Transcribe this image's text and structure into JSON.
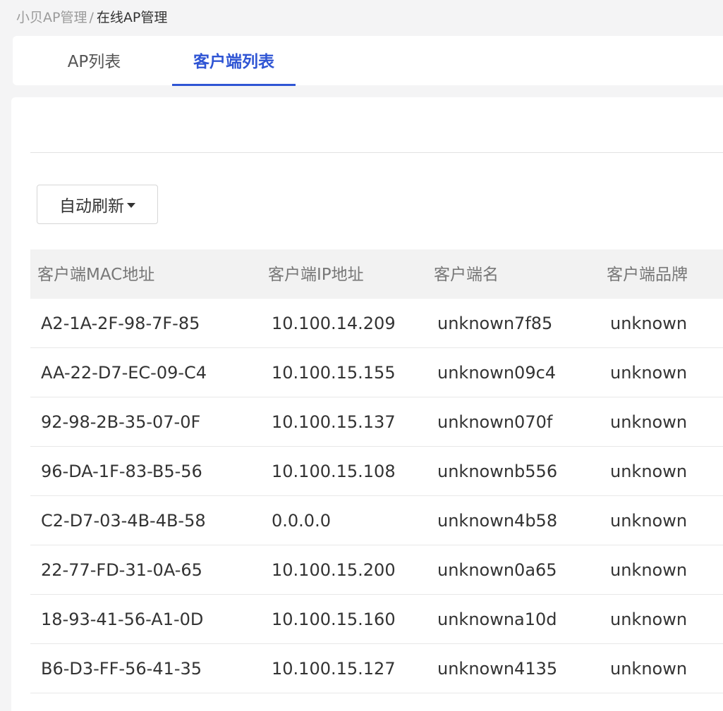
{
  "breadcrumb": {
    "root": "小贝AP管理",
    "separator": "/",
    "current": "在线AP管理"
  },
  "tabs": [
    {
      "label": "AP列表",
      "active": false
    },
    {
      "label": "客户端列表",
      "active": true
    }
  ],
  "toolbar": {
    "refresh_label": "自动刷新",
    "refresh_icon": "caret-down-icon"
  },
  "colors": {
    "accent": "#2f55d4",
    "header_bg": "#f2f2f2",
    "page_bg": "#f4f4f5"
  },
  "table": {
    "columns": [
      "客户端MAC地址",
      "客户端IP地址",
      "客户端名",
      "客户端品牌"
    ],
    "rows": [
      {
        "mac": "A2-1A-2F-98-7F-85",
        "ip": "10.100.14.209",
        "name": "unknown7f85",
        "brand": "unknown"
      },
      {
        "mac": "AA-22-D7-EC-09-C4",
        "ip": "10.100.15.155",
        "name": "unknown09c4",
        "brand": "unknown"
      },
      {
        "mac": "92-98-2B-35-07-0F",
        "ip": "10.100.15.137",
        "name": "unknown070f",
        "brand": "unknown"
      },
      {
        "mac": "96-DA-1F-83-B5-56",
        "ip": "10.100.15.108",
        "name": "unknownb556",
        "brand": "unknown"
      },
      {
        "mac": "C2-D7-03-4B-4B-58",
        "ip": "0.0.0.0",
        "name": "unknown4b58",
        "brand": "unknown"
      },
      {
        "mac": "22-77-FD-31-0A-65",
        "ip": "10.100.15.200",
        "name": "unknown0a65",
        "brand": "unknown"
      },
      {
        "mac": "18-93-41-56-A1-0D",
        "ip": "10.100.15.160",
        "name": "unknowna10d",
        "brand": "unknown"
      },
      {
        "mac": "B6-D3-FF-56-41-35",
        "ip": "10.100.15.127",
        "name": "unknown4135",
        "brand": "unknown"
      }
    ]
  }
}
